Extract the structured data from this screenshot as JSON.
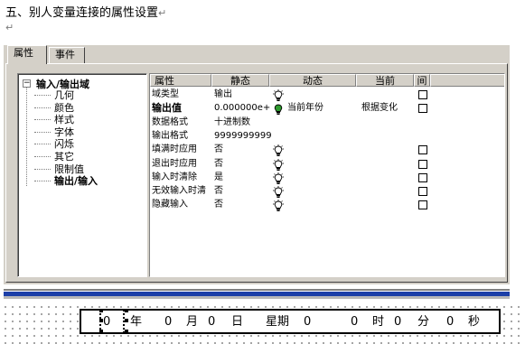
{
  "document": {
    "heading": "五、别人变量连接的属性设置",
    "para_mark": "↵"
  },
  "dialog": {
    "tabs": [
      "属性",
      "事件"
    ],
    "tree": {
      "root": "输入/输出域",
      "items": [
        "几何",
        "颜色",
        "样式",
        "字体",
        "闪烁",
        "其它",
        "限制值",
        "输出/输入"
      ],
      "selected_index": 7
    },
    "grid": {
      "columns": [
        "属性",
        "静态",
        "动态",
        "当前",
        "间",
        ""
      ],
      "rows": [
        {
          "prop": "域类型",
          "static": "输出",
          "dyn_icon": "bulb-off",
          "dynamic": "",
          "current": "",
          "bold": false
        },
        {
          "prop": "输出值",
          "static": "0.000000e+",
          "dyn_icon": "bulb-on",
          "dynamic": "当前年份",
          "current": "根据变化",
          "bold": true
        },
        {
          "prop": "数据格式",
          "static": "十进制数",
          "dyn_icon": "",
          "dynamic": "",
          "current": "",
          "bold": false
        },
        {
          "prop": "输出格式",
          "static": "9999999999",
          "dyn_icon": "",
          "dynamic": "",
          "current": "",
          "bold": false
        },
        {
          "prop": "填满时应用",
          "static": "否",
          "dyn_icon": "bulb-off",
          "dynamic": "",
          "current": "",
          "bold": false
        },
        {
          "prop": "退出时应用",
          "static": "否",
          "dyn_icon": "bulb-off",
          "dynamic": "",
          "current": "",
          "bold": false
        },
        {
          "prop": "输入时清除",
          "static": "是",
          "dyn_icon": "bulb-off",
          "dynamic": "",
          "current": "",
          "bold": false
        },
        {
          "prop": "无效输入时清",
          "static": "否",
          "dyn_icon": "bulb-off",
          "dynamic": "",
          "current": "",
          "bold": false
        },
        {
          "prop": "隐藏输入",
          "static": "否",
          "dyn_icon": "bulb-off",
          "dynamic": "",
          "current": "",
          "bold": false
        }
      ],
      "checkbox_rows": [
        0,
        1,
        4,
        5,
        6,
        7,
        8
      ]
    }
  },
  "clock": {
    "items": [
      "0",
      "年",
      "0",
      "月",
      "0",
      "日",
      "星期",
      "0",
      "0",
      "时",
      "0",
      "分",
      "0",
      "秒"
    ]
  },
  "colors": {
    "window": "#d4d0c8",
    "accent_bar": "#1c3fa8",
    "bulb_on": "#2e9a2e"
  }
}
